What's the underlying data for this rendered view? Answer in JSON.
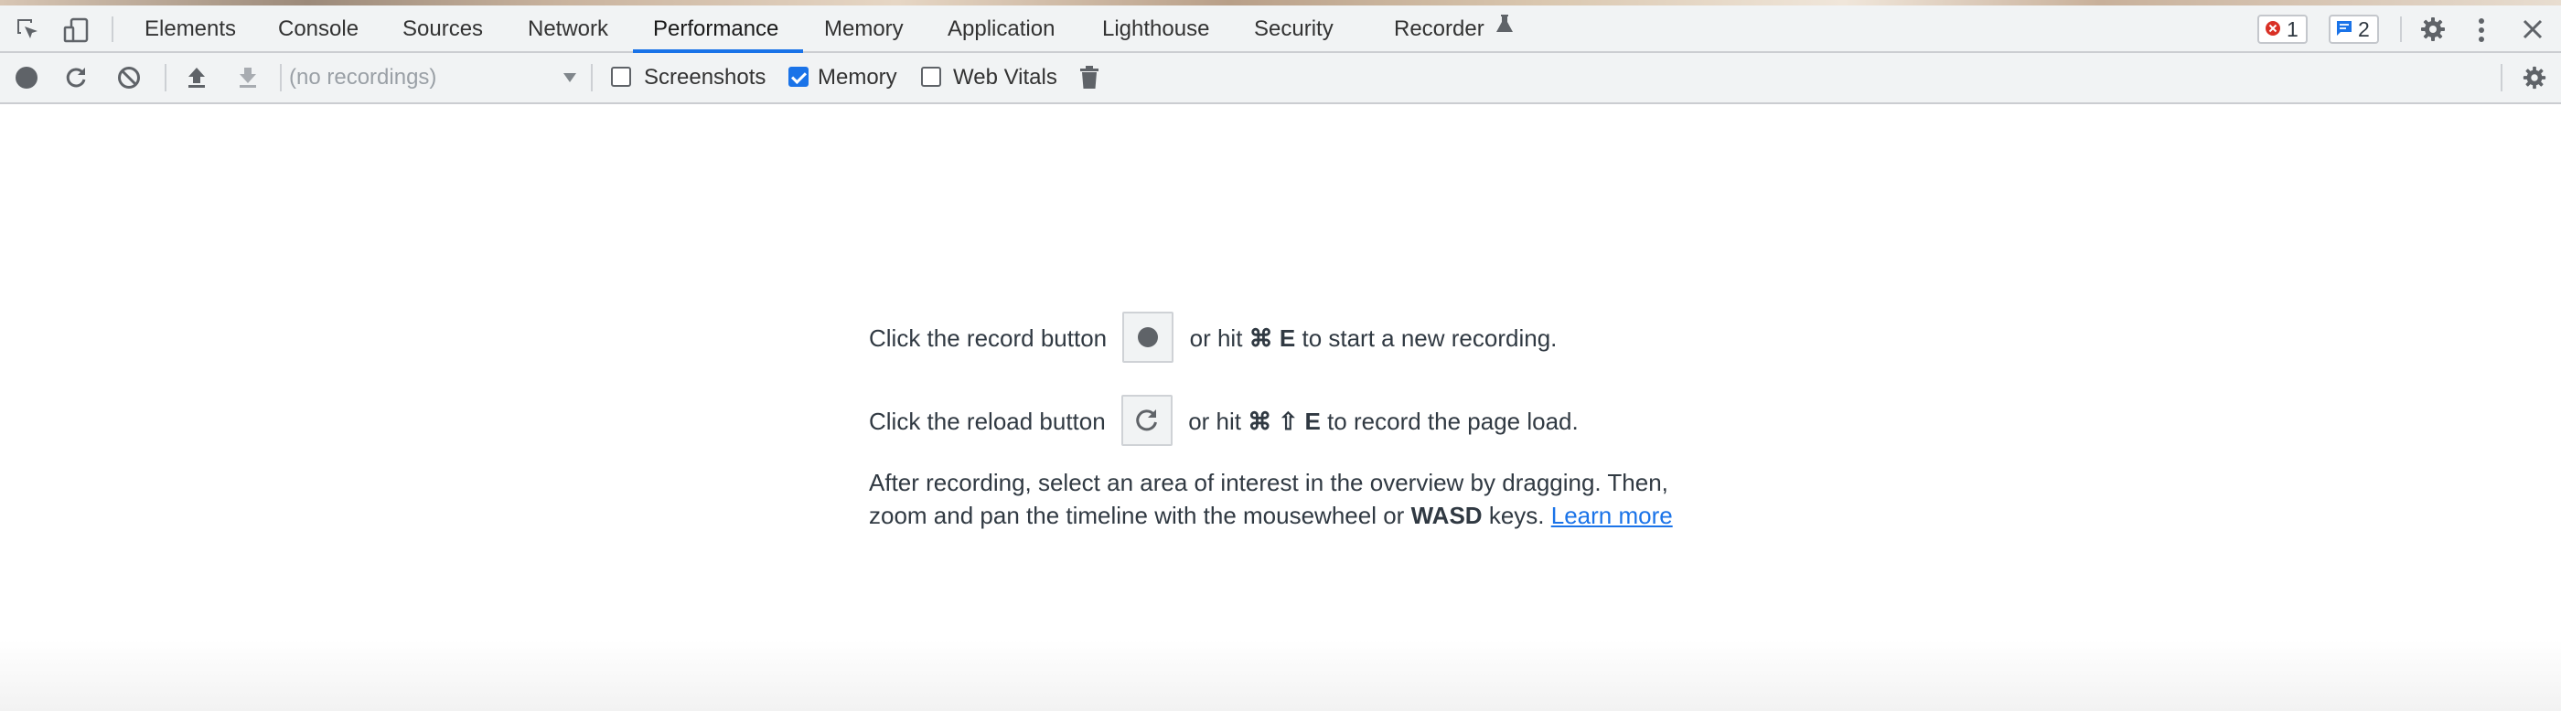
{
  "tabs": [
    {
      "label": "Elements",
      "active": false
    },
    {
      "label": "Console",
      "active": false
    },
    {
      "label": "Sources",
      "active": false
    },
    {
      "label": "Network",
      "active": false
    },
    {
      "label": "Performance",
      "active": true
    },
    {
      "label": "Memory",
      "active": false
    },
    {
      "label": "Application",
      "active": false
    },
    {
      "label": "Lighthouse",
      "active": false
    },
    {
      "label": "Security",
      "active": false
    },
    {
      "label": "Recorder",
      "active": false
    }
  ],
  "badges": {
    "errors": "1",
    "issues": "2"
  },
  "toolbar": {
    "recordings_placeholder": "(no recordings)",
    "checkboxes": [
      {
        "label": "Screenshots",
        "checked": false
      },
      {
        "label": "Memory",
        "checked": true
      },
      {
        "label": "Web Vitals",
        "checked": false
      }
    ]
  },
  "landing": {
    "record_prefix": "Click the record button",
    "record_suffix_a": "or hit",
    "record_key_cmd": "⌘",
    "record_key": "E",
    "record_suffix_b": "to start a new recording.",
    "reload_prefix": "Click the reload button",
    "reload_suffix_a": "or hit",
    "reload_key_cmd": "⌘",
    "reload_key_shift": "⇧",
    "reload_key": "E",
    "reload_suffix_b": "to record the page load.",
    "hint_part1": "After recording, select an area of interest in the overview by dragging. Then, zoom and pan the timeline with the mousewheel or",
    "hint_keys": "WASD",
    "hint_part2": "keys.",
    "learn_more": "Learn more"
  },
  "icons": {
    "inspect": "inspect-element-icon",
    "device": "device-toolbar-icon",
    "flask": "experiment-flask-icon",
    "error": "error-circle-icon",
    "issue": "issue-message-icon",
    "settings": "gear-icon",
    "more": "kebab-menu-icon",
    "close": "close-icon",
    "record": "record-icon",
    "reload": "reload-icon",
    "clear": "clear-icon",
    "upload": "load-profile-icon",
    "download": "save-profile-icon",
    "trash": "trash-icon"
  },
  "colors": {
    "accent": "#1a73e8",
    "error": "#d93025",
    "toolbar_bg": "#f1f3f4"
  }
}
